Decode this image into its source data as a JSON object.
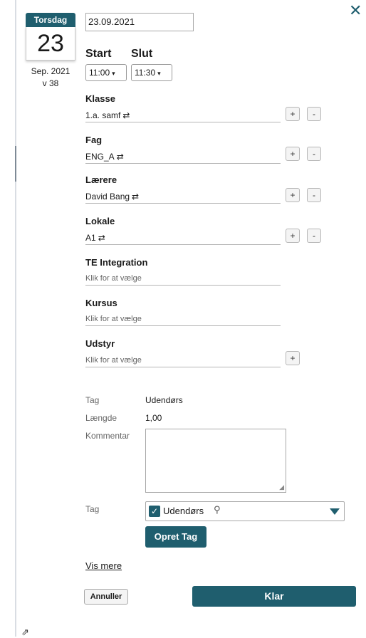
{
  "calendar": {
    "weekday": "Torsdag",
    "day": "23",
    "month": "Sep. 2021",
    "week": "v 38"
  },
  "date_value": "23.09.2021",
  "start": {
    "label": "Start",
    "value": "11:00"
  },
  "slut": {
    "label": "Slut",
    "value": "11:30"
  },
  "icons": {
    "close": "close-icon",
    "swap": "⇄",
    "chevron": "▾",
    "search": "search-icon",
    "external": "external-link-icon"
  },
  "fields": [
    {
      "label": "Klasse",
      "value": "1.a. samf",
      "swap": true
    },
    {
      "label": "Fag",
      "value": "ENG_A",
      "swap": true
    },
    {
      "label": "Lærere",
      "value": "David Bang",
      "swap": true
    },
    {
      "label": "Lokale",
      "value": "A1",
      "swap": true
    },
    {
      "label": "TE Integration",
      "placeholder": "Klik for at vælge"
    },
    {
      "label": "Kursus",
      "placeholder": "Klik for at vælge"
    },
    {
      "label": "Udstyr",
      "placeholder": "Klik for at vælge"
    }
  ],
  "plus_label": "+",
  "minus_label": "-",
  "info": {
    "tag_label": "Tag",
    "tag_value": "Udendørs",
    "length_label": "Længde",
    "length_value": "1,00",
    "comment_label": "Kommentar"
  },
  "tag_select": {
    "label": "Tag",
    "selected": "Udendørs"
  },
  "create_tag_button": "Opret Tag",
  "show_more_link": "Vis mere",
  "cancel_button": "Annuller",
  "ok_button": "Klar",
  "colors": {
    "accent": "#1f5e6e"
  }
}
